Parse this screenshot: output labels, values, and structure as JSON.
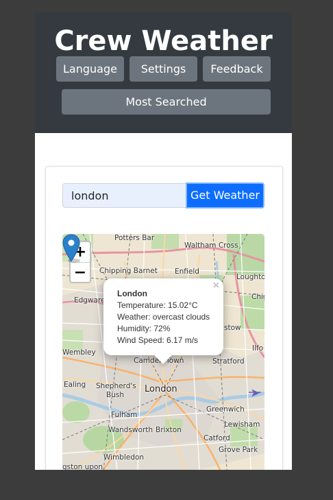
{
  "header": {
    "title": "Crew Weather",
    "nav": {
      "language": "Language",
      "settings": "Settings",
      "feedback": "Feedback",
      "most_searched": "Most Searched"
    }
  },
  "search": {
    "value": "london",
    "button": "Get Weather"
  },
  "map": {
    "zoom_in": "+",
    "zoom_out": "−",
    "popup": {
      "close": "×",
      "city": "London",
      "temperature": "Temperature: 15.02°C",
      "weather": "Weather: overcast clouds",
      "humidity": "Humidity: 72%",
      "wind": "Wind Speed: 6.17 m/s"
    },
    "labels": {
      "potters_bar": "Potters Bar",
      "waltham_cross": "Waltham Cross",
      "chipping_barnet": "Chipping Barnet",
      "enfield": "Enfield",
      "loughton": "Loughto",
      "edgware": "Edgware",
      "chig": "Chig",
      "stow": "stow",
      "wembley": "Wembley",
      "ilford": "Ilfo",
      "camden": "Camden Town",
      "stratford": "Stratford",
      "ealing": "Ealing",
      "shepherds": "Shepherd's",
      "bush": "Bush",
      "london": "London",
      "greenwich": "Greenwich",
      "fulham": "Fulham",
      "lewisham": "Lewisham",
      "wandsworth": "Wandsworth",
      "brixton": "Brixton",
      "catford": "Catford",
      "grove_park": "Grove Park",
      "wimbledon": "Wimbledon",
      "kingston": "gston upon"
    }
  },
  "colors": {
    "header_bg": "#343a40",
    "nav_button": "#6c757d",
    "primary": "#0d6efd",
    "marker": "#2a81cb"
  }
}
